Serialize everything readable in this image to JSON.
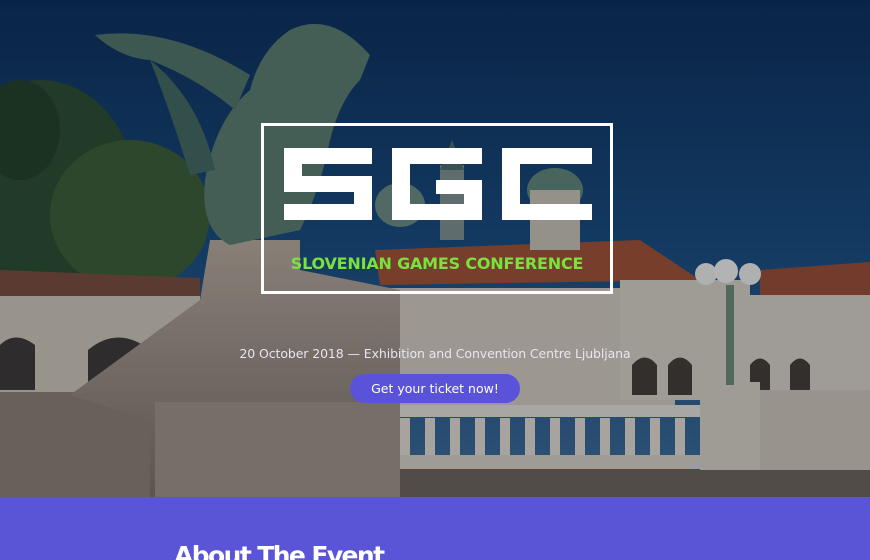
{
  "hero": {
    "logo": {
      "letters": "SGC",
      "subtitle": "SLOVENIAN GAMES CONFERENCE"
    },
    "event_line": "20 October 2018 — Exhibition and Convention Centre Ljubljana",
    "cta_label": "Get your ticket now!"
  },
  "about": {
    "title": "About The Event"
  },
  "colors": {
    "accent": "#5a54d6",
    "button": "#5b52da",
    "subtitle_green": "#7ae23c",
    "logo_white": "#ffffff"
  }
}
